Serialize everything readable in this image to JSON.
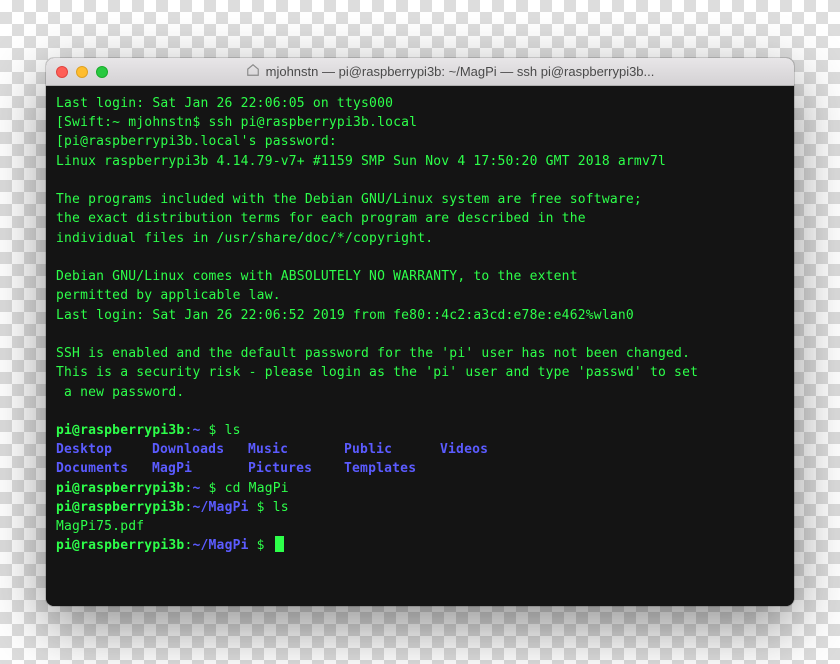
{
  "window": {
    "title": "mjohnstn — pi@raspberrypi3b: ~/MagPi — ssh pi@raspberrypi3b..."
  },
  "terminal": {
    "lines": {
      "last_login_local": "Last login: Sat Jan 26 22:06:05 on ttys000",
      "local_prompt": "[Swift:~ mjohnstn$ ssh pi@raspberrypi3b.local",
      "password_prompt": "[pi@raspberrypi3b.local's password:",
      "linux_banner": "Linux raspberrypi3b 4.14.79-v7+ #1159 SMP Sun Nov 4 17:50:20 GMT 2018 armv7l",
      "motd1": "The programs included with the Debian GNU/Linux system are free software;",
      "motd2": "the exact distribution terms for each program are described in the",
      "motd3": "individual files in /usr/share/doc/*/copyright.",
      "motd4": "Debian GNU/Linux comes with ABSOLUTELY NO WARRANTY, to the extent",
      "motd5": "permitted by applicable law.",
      "last_login_remote": "Last login: Sat Jan 26 22:06:52 2019 from fe80::4c2:a3cd:e78e:e462%wlan0",
      "ssh_warn1": "SSH is enabled and the default password for the 'pi' user has not been changed.",
      "ssh_warn2": "This is a security risk - please login as the 'pi' user and type 'passwd' to set",
      "ssh_warn3": " a new password.",
      "prompt1_user": "pi@raspberrypi3b",
      "prompt1_path": "~",
      "prompt1_sep": ":",
      "prompt1_dollar": " $ ",
      "cmd1": "ls",
      "prompt2_user": "pi@raspberrypi3b",
      "prompt2_path": "~",
      "prompt2_dollar": " $ ",
      "cmd2": "cd MagPi",
      "prompt3_user": "pi@raspberrypi3b",
      "prompt3_path": "~/MagPi",
      "prompt3_dollar": " $ ",
      "cmd3": "ls",
      "ls_output2": "MagPi75.pdf",
      "prompt4_user": "pi@raspberrypi3b",
      "prompt4_path": "~/MagPi",
      "prompt4_dollar": " $ "
    },
    "ls_row1": {
      "c0": "Desktop",
      "c1": "Downloads",
      "c2": "Music",
      "c3": "Public",
      "c4": "Videos"
    },
    "ls_row2": {
      "c0": "Documents",
      "c1": "MagPi",
      "c2": "Pictures",
      "c3": "Templates",
      "c4": ""
    }
  }
}
